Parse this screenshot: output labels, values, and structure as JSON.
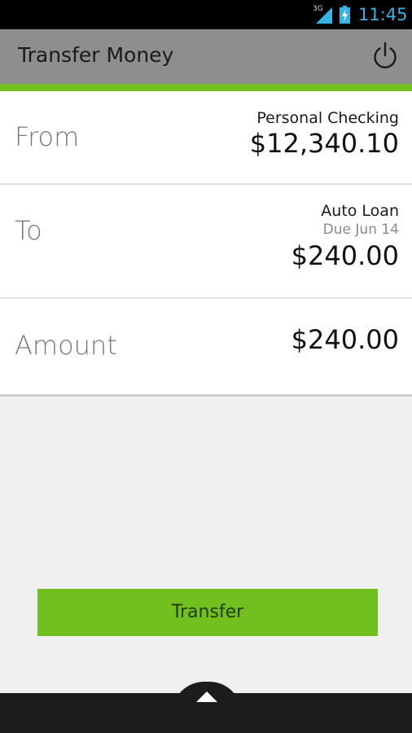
{
  "status_bar": {
    "network_label": "3G",
    "time": "11:45"
  },
  "header": {
    "title": "Transfer Money",
    "power_icon": "power-icon"
  },
  "accent_color": "#74bf1e",
  "rows": {
    "from": {
      "label": "From",
      "account_name": "Personal Checking",
      "amount": "$12,340.10"
    },
    "to": {
      "label": "To",
      "account_name": "Auto Loan",
      "due": "Due Jun 14",
      "amount": "$240.00"
    },
    "amount": {
      "label": "Amount",
      "value": "$240.00"
    }
  },
  "actions": {
    "transfer_label": "Transfer"
  },
  "bottom_bar": {
    "handle_icon": "chevron-up-icon"
  }
}
